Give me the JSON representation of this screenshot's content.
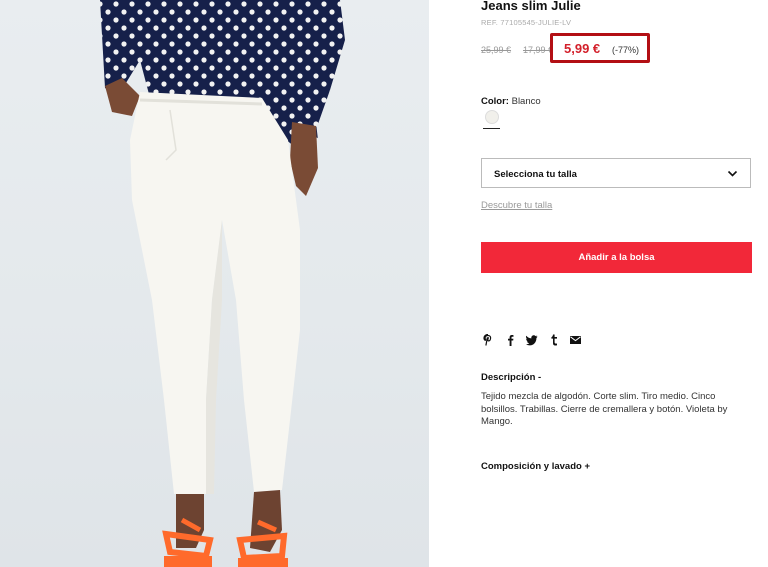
{
  "product": {
    "title": "Jeans slim Julie",
    "ref": "REF. 77105545-JULIE-LV",
    "old_price_1": "25,99 €",
    "old_price_2": "17,99 €",
    "price": "5,99 €",
    "discount": "(-77%)"
  },
  "color": {
    "label": "Color:",
    "value": "Blanco",
    "swatch_hex": "#f1f0eb"
  },
  "size": {
    "select_label": "Selecciona tu talla",
    "guide_link": "Descubre tu talla"
  },
  "cart": {
    "add_label": "Añadir a la bolsa",
    "button_color": "#f22839"
  },
  "share": {
    "icons": [
      "pinterest-icon",
      "facebook-icon",
      "twitter-icon",
      "tumblr-icon",
      "email-icon"
    ]
  },
  "description": {
    "heading": "Descripción",
    "toggle": "-",
    "text": "Tejido mezcla de algodón. Corte slim. Tiro medio. Cinco bolsillos. Trabillas. Cierre de cremallera y botón. Violeta by Mango."
  },
  "composition": {
    "heading": "Composición y lavado",
    "toggle": "+"
  },
  "colors": {
    "price_red": "#d31f2a",
    "highlight_box": "#b30f14"
  }
}
